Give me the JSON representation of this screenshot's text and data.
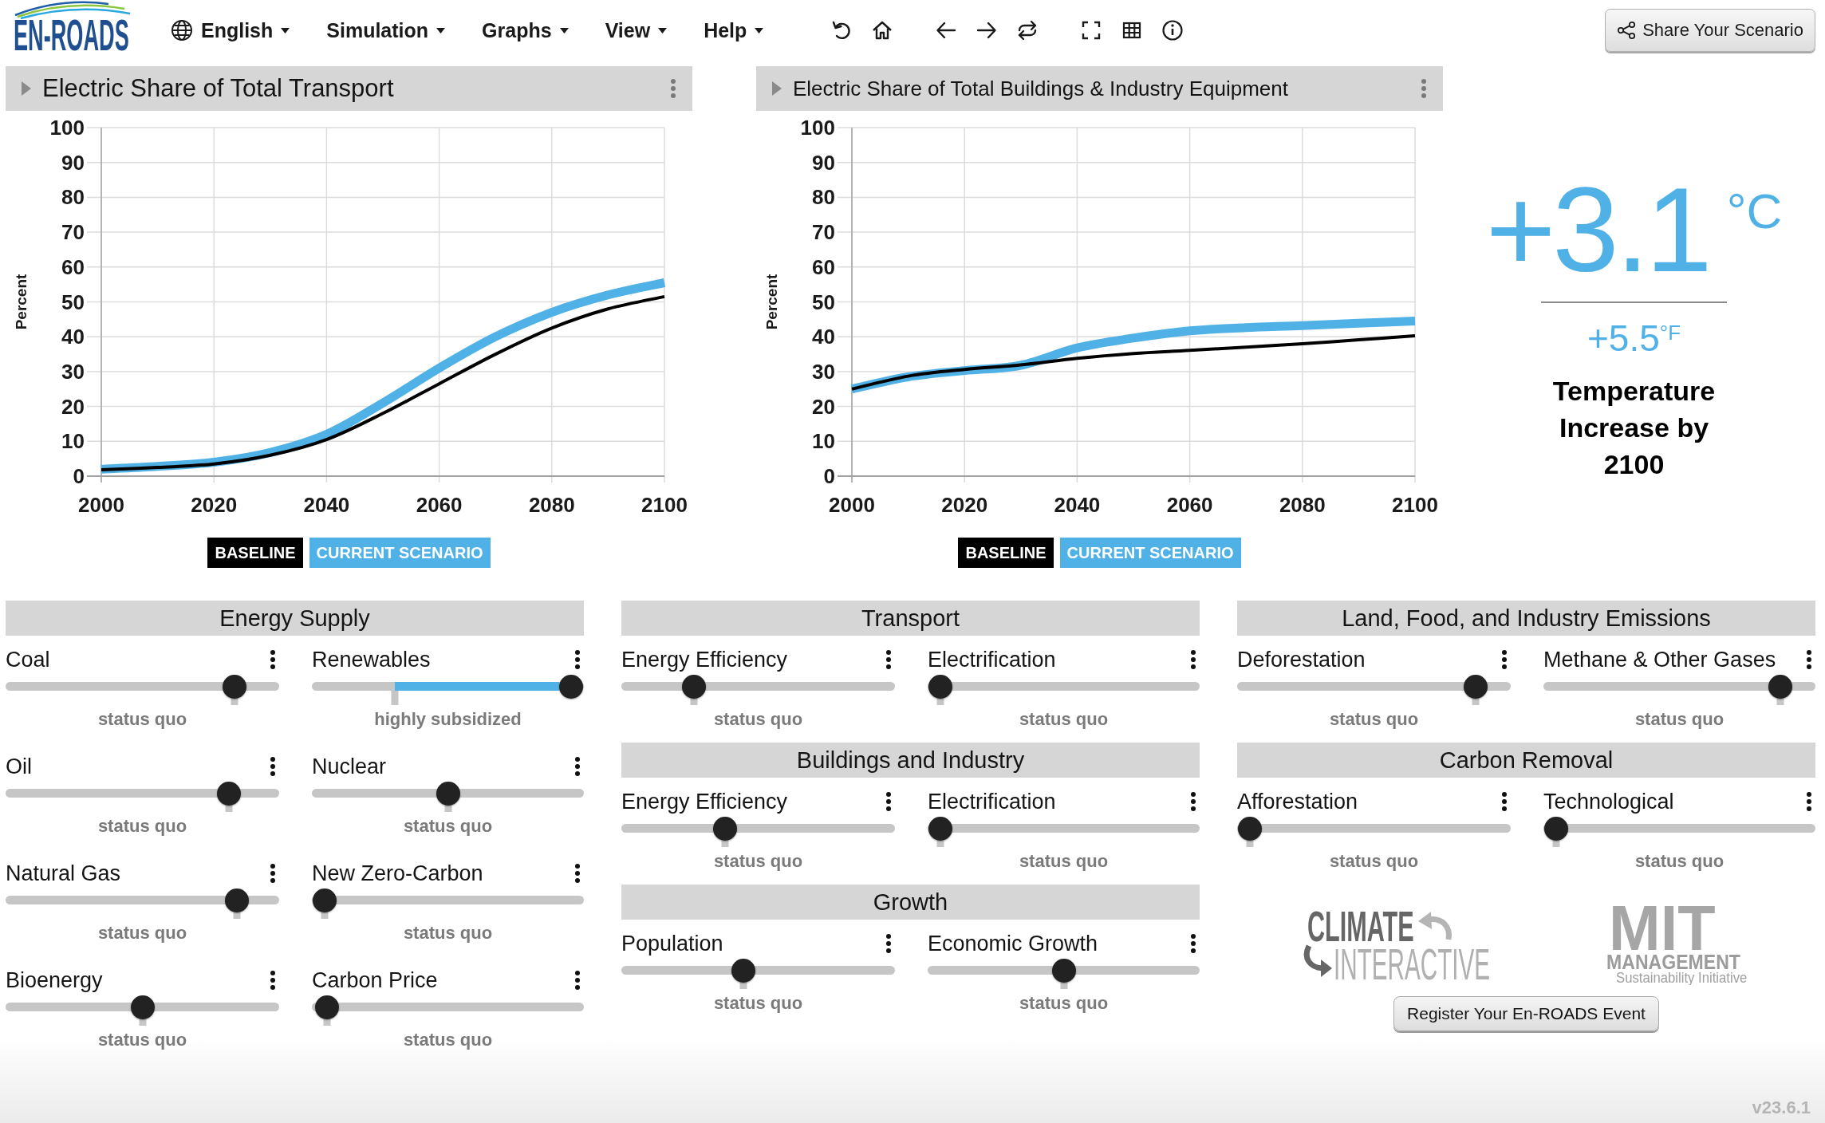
{
  "header": {
    "logo": "EN-ROADS",
    "menu": [
      {
        "label": "English",
        "kind": "language"
      },
      {
        "label": "Simulation",
        "kind": "dropdown"
      },
      {
        "label": "Graphs",
        "kind": "dropdown"
      },
      {
        "label": "View",
        "kind": "dropdown"
      },
      {
        "label": "Help",
        "kind": "dropdown"
      }
    ],
    "share_button": "Share Your Scenario"
  },
  "graphs": [
    {
      "title": "Electric Share of Total Transport",
      "chart_data": {
        "type": "line",
        "ylabel": "Percent",
        "x": [
          2000,
          2010,
          2020,
          2030,
          2040,
          2050,
          2060,
          2070,
          2080,
          2090,
          2100
        ],
        "xlim": [
          2000,
          2100
        ],
        "ylim": [
          0,
          100
        ],
        "xticks": [
          2000,
          2020,
          2040,
          2060,
          2080,
          2100
        ],
        "yticks": [
          0,
          10,
          20,
          30,
          40,
          50,
          60,
          70,
          80,
          90,
          100
        ],
        "grid": true,
        "legend": "bottom",
        "series": [
          {
            "name": "BASELINE",
            "color": "#000000",
            "values": [
              1.8,
              2.5,
              3.5,
              6,
              10.5,
              18,
              26.5,
              35,
              42.5,
              48,
              51.5
            ]
          },
          {
            "name": "CURRENT SCENARIO",
            "color": "#4fb1e6",
            "values": [
              2,
              2.8,
              4,
              6.8,
              12,
              21,
              31,
              40,
              47,
              52,
              55.5
            ]
          }
        ]
      }
    },
    {
      "title": "Electric Share of Total Buildings & Industry Equipment",
      "chart_data": {
        "type": "line",
        "ylabel": "Percent",
        "x": [
          2000,
          2010,
          2020,
          2030,
          2040,
          2050,
          2060,
          2070,
          2080,
          2090,
          2100
        ],
        "xlim": [
          2000,
          2100
        ],
        "ylim": [
          0,
          100
        ],
        "xticks": [
          2000,
          2020,
          2040,
          2060,
          2080,
          2100
        ],
        "yticks": [
          0,
          10,
          20,
          30,
          40,
          50,
          60,
          70,
          80,
          90,
          100
        ],
        "grid": true,
        "legend": "bottom",
        "series": [
          {
            "name": "BASELINE",
            "color": "#000000",
            "values": [
              25,
              28.7,
              30.6,
              31.9,
              33.8,
              35.2,
              36.1,
              37,
              38,
              39.1,
              40.3
            ]
          },
          {
            "name": "CURRENT SCENARIO",
            "color": "#4fb1e6",
            "values": [
              25,
              28.5,
              30.3,
              31.8,
              36.8,
              39.6,
              41.7,
              42.6,
              43.2,
              43.9,
              44.5
            ]
          }
        ]
      }
    }
  ],
  "temperature": {
    "celsius": {
      "value": "+3.1",
      "unit": "°C"
    },
    "fahrenheit": {
      "value": "+5.5",
      "unit": "°F"
    },
    "caption": "Temperature Increase by 2100"
  },
  "control_columns": [
    {
      "groups": [
        {
          "title": "Energy Supply",
          "sliders": [
            {
              "label": "Coal",
              "level": 0.87,
              "status_quo": {
                "level": 0.87
              },
              "caption": "status quo"
            },
            {
              "label": "Renewables",
              "level": 1,
              "status_quo": {
                "level": 0.285
              },
              "caption": "highly subsidized"
            },
            {
              "label": "Oil",
              "level": 0.85,
              "status_quo": {
                "level": 0.85
              },
              "caption": "status quo"
            },
            {
              "label": "Nuclear",
              "level": 0.5,
              "status_quo": {
                "level": 0.5
              },
              "caption": "status quo"
            },
            {
              "label": "Natural Gas",
              "level": 0.88,
              "status_quo": {
                "level": 0.88
              },
              "caption": "status quo"
            },
            {
              "label": "New Zero-Carbon",
              "level": 0,
              "status_quo": {
                "level": 0
              },
              "caption": "status quo"
            },
            {
              "label": "Bioenergy",
              "level": 0.5,
              "status_quo": {
                "level": 0.5
              },
              "caption": "status quo"
            },
            {
              "label": "Carbon Price",
              "level": 0.01,
              "status_quo": {
                "level": 0.01
              },
              "caption": "status quo"
            }
          ]
        }
      ]
    },
    {
      "groups": [
        {
          "title": "Transport",
          "sliders": [
            {
              "label": "Energy Efficiency",
              "level": 0.24,
              "status_quo": {
                "level": 0.24
              },
              "caption": "status quo"
            },
            {
              "label": "Electrification",
              "level": 0,
              "status_quo": {
                "level": 0
              },
              "caption": "status quo"
            }
          ]
        },
        {
          "title": "Buildings and Industry",
          "sliders": [
            {
              "label": "Energy Efficiency",
              "level": 0.365,
              "status_quo": {
                "level": 0.365
              },
              "caption": "status quo"
            },
            {
              "label": "Electrification",
              "level": 0,
              "status_quo": {
                "level": 0
              },
              "caption": "status quo"
            }
          ]
        },
        {
          "title": "Growth",
          "sliders": [
            {
              "label": "Population",
              "level": 0.44,
              "status_quo": {
                "level": 0.44
              },
              "caption": "status quo"
            },
            {
              "label": "Economic Growth",
              "level": 0.5,
              "status_quo": {
                "level": 0.5
              },
              "caption": "status quo"
            }
          ]
        }
      ]
    },
    {
      "groups": [
        {
          "title": "Land, Food, and Industry Emissions",
          "sliders": [
            {
              "label": "Deforestation",
              "level": 0.91,
              "status_quo": {
                "level": 0.91
              },
              "caption": "status quo"
            },
            {
              "label": "Methane & Other Gases",
              "level": 0.91,
              "status_quo": {
                "level": 0.91
              },
              "caption": "status quo"
            }
          ]
        },
        {
          "title": "Carbon Removal",
          "sliders": [
            {
              "label": "Afforestation",
              "level": 0,
              "status_quo": {
                "level": 0
              },
              "caption": "status quo"
            },
            {
              "label": "Technological",
              "level": 0,
              "status_quo": {
                "level": 0
              },
              "caption": "status quo"
            }
          ]
        }
      ]
    }
  ],
  "partner_logos": [
    {
      "kind": "climate_interactive",
      "lines": [
        "CLIMATE",
        "INTERACTIVE"
      ]
    },
    {
      "kind": "mit",
      "lines": [
        "MIT",
        "MANAGEMENT",
        "Sustainability Initiative"
      ]
    }
  ],
  "register_button": "Register Your En-ROADS Event",
  "version": "v23.6.1"
}
